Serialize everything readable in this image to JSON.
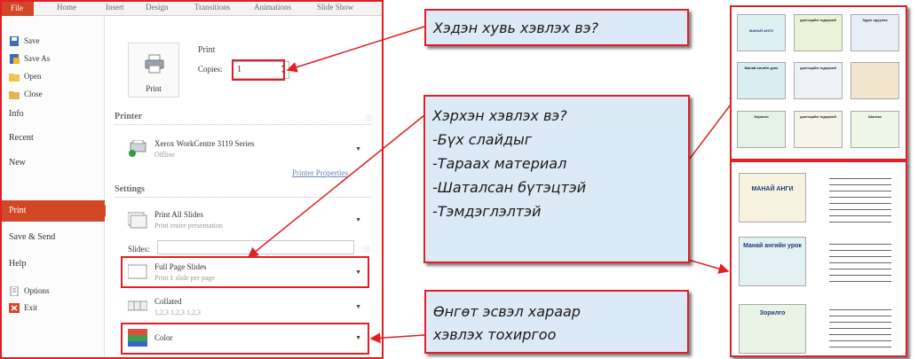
{
  "ribbon": {
    "tabs": [
      "File",
      "Home",
      "Insert",
      "Design",
      "Transitions",
      "Animations",
      "Slide Show"
    ]
  },
  "nav": {
    "save": "Save",
    "save_as": "Save As",
    "open": "Open",
    "close": "Close",
    "info": "Info",
    "recent": "Recent",
    "new": "New",
    "print": "Print",
    "save_send": "Save & Send",
    "help": "Help",
    "options": "Options",
    "exit": "Exit"
  },
  "print_panel": {
    "print_button_label": "Print",
    "heading": "Print",
    "copies_label": "Copies:",
    "copies_value": "1",
    "printer_section": "Printer",
    "printer_name": "Xerox WorkCentre 3119 Series",
    "printer_status": "Offline",
    "printer_properties_link": "Printer Properties",
    "settings_section": "Settings",
    "slides_label": "Slides:",
    "print_all_title": "Print All Slides",
    "print_all_sub": "Print entire presentation",
    "layout_title": "Full Page Slides",
    "layout_sub": "Print 1 slide per page",
    "collate_title": "Collated",
    "collate_sub": "1,2,3   1,2,3   1,2,3",
    "color_title": "Color"
  },
  "callouts": {
    "copies": "Хэдэн хувь хэвлэх вэ?",
    "what_to_print": [
      "Хэрхэн хэвлэх вэ?",
      "-Бүх слайдыг",
      "-Тараах материал",
      "-Шаталсан бүтэцтэй",
      "-Тэмдэглэлтэй"
    ],
    "color": [
      "Өнгөт эсвэл хараар",
      "хэвлэх тохиргоо"
    ]
  },
  "thumbnails": {
    "grid": [
      "МАНАЙ АНГИ",
      "дэлгэцийн тодорхой",
      "Зураг оруулах",
      "Манай ангийн урок",
      "дэлгэцийн тодорхой",
      "",
      "Зорилго",
      "дэлгэцийн тодорхой",
      "Шалгах"
    ],
    "notes": [
      "МАНАЙ АНГИ",
      "Манай ангийн урок",
      "Зорилго"
    ]
  },
  "colors": {
    "accent": "#d24726",
    "highlight": "#e31e24",
    "callout_bg": "#dce9f6"
  }
}
